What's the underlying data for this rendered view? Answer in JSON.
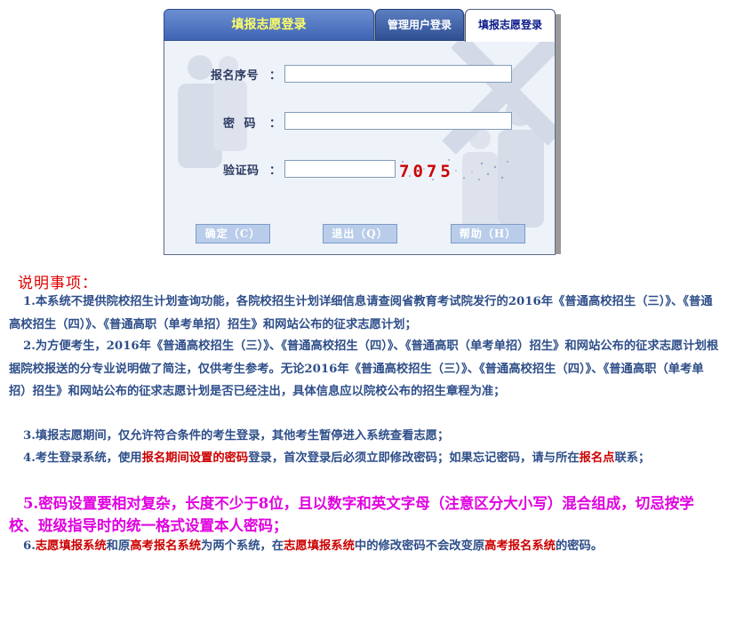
{
  "tabs": {
    "main": "填报志愿登录",
    "admin": "管理用户登录",
    "fill": "填报志愿登录"
  },
  "form": {
    "reg_no_label": "报名序号",
    "password_label": "密  码",
    "captcha_label": "验证码",
    "colon": "：",
    "reg_no_value": "",
    "password_value": "",
    "captcha_value": "",
    "captcha_text": "7075"
  },
  "buttons": {
    "ok": "确定（C）",
    "exit": "退出（Q）",
    "help": "帮助（H）"
  },
  "instructions": {
    "title": "说明事项：",
    "p1": "1.本系统不提供院校招生计划查询功能，各院校招生计划详细信息请查阅省教育考试院发行的2016年《普通高校招生（三）》、《普通高校招生（四）》、《普通高职（单考单招）招生》和网站公布的征求志愿计划；",
    "p2": "2.为方便考生，2016年《普通高校招生（三）》、《普通高校招生（四）》、《普通高职（单考单招）招生》和网站公布的征求志愿计划根据院校报送的分专业说明做了简注，仅供考生参考。无论2016年《普通高校招生（三）》、《普通高校招生（四）》、《普通高职（单考单招）招生》和网站公布的征求志愿计划是否已经注出，具体信息应以院校公布的招生章程为准；",
    "p3": "3.填报志愿期间，仅允许符合条件的考生登录，其他考生暂停进入系统查看志愿；",
    "p4a": "4.考生登录系统，使用",
    "p4b": "报名期间设置的密码",
    "p4c": "登录，首次登录后必须立即修改密码；如果忘记密码，请与所在",
    "p4d": "报名点",
    "p4e": "联系；",
    "p5": "5.密码设置要相对复杂，长度不少于8位，且以数字和英文字母（注意区分大小写）混合组成，切忌按学校、班级指导时的统一格式设置本人密码；",
    "p6a": "6.",
    "p6b": "志愿填报系统",
    "p6c": "和原",
    "p6d": "高考报名系统",
    "p6e": "为两个系统，在",
    "p6f": "志愿填报系统",
    "p6g": "中的修改密码不会改变原",
    "p6h": "高考报名系统",
    "p6i": "的密码。"
  },
  "colors": {
    "accent": "#3f64b3",
    "title_red": "#e00000",
    "highlight_red": "#cc0000",
    "magenta": "#e000e0",
    "text_blue": "#2f4f8a"
  }
}
